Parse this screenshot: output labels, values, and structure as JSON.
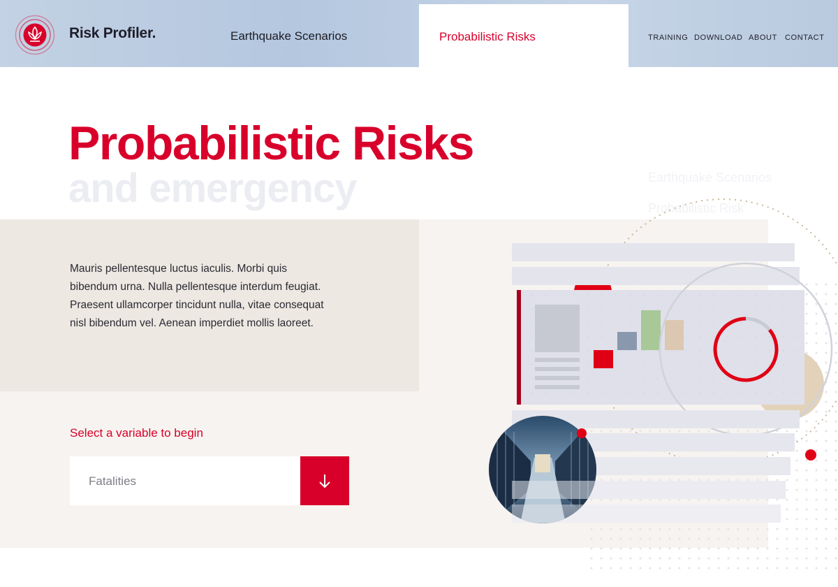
{
  "header": {
    "brand": "Risk Profiler.",
    "nav_main": [
      "Earthquake Scenarios",
      "Probabilistic Risks"
    ],
    "active_tab": "Probabilistic Risks",
    "nav_util": [
      "TRAINING",
      "DOWNLOAD",
      "ABOUT",
      "CONTACT"
    ]
  },
  "hero": {
    "title": "Probabilistic Risks",
    "ghost_line": "and emergency",
    "ghost_side": [
      "Earthquake Scenarios",
      "Probabilistic Risk"
    ]
  },
  "intro": {
    "text": "Mauris pellentesque luctus iaculis. Morbi quis bibendum urna. Nulla pellentesque interdum feugiat. Praesent ullamcorper tincidunt nulla, vitae consequat nisl bibendum vel. Aenean imperdiet mollis laoreet."
  },
  "selector": {
    "label": "Select a variable to begin",
    "value": "Fatalities",
    "button_icon": "arrow-down-icon"
  },
  "colors": {
    "accent": "#d8002b",
    "header_bg": "#b4c7df",
    "panel_dark": "#ede8e2",
    "panel_light": "#f7f3f0",
    "bar_gray": "#8a98ad",
    "bar_green": "#a8c898",
    "bar_tan": "#dcc8b0",
    "bar_red": "#e00015"
  },
  "icons": {
    "logo": "lotus-logo-icon",
    "select_button": "arrow-down-icon"
  }
}
